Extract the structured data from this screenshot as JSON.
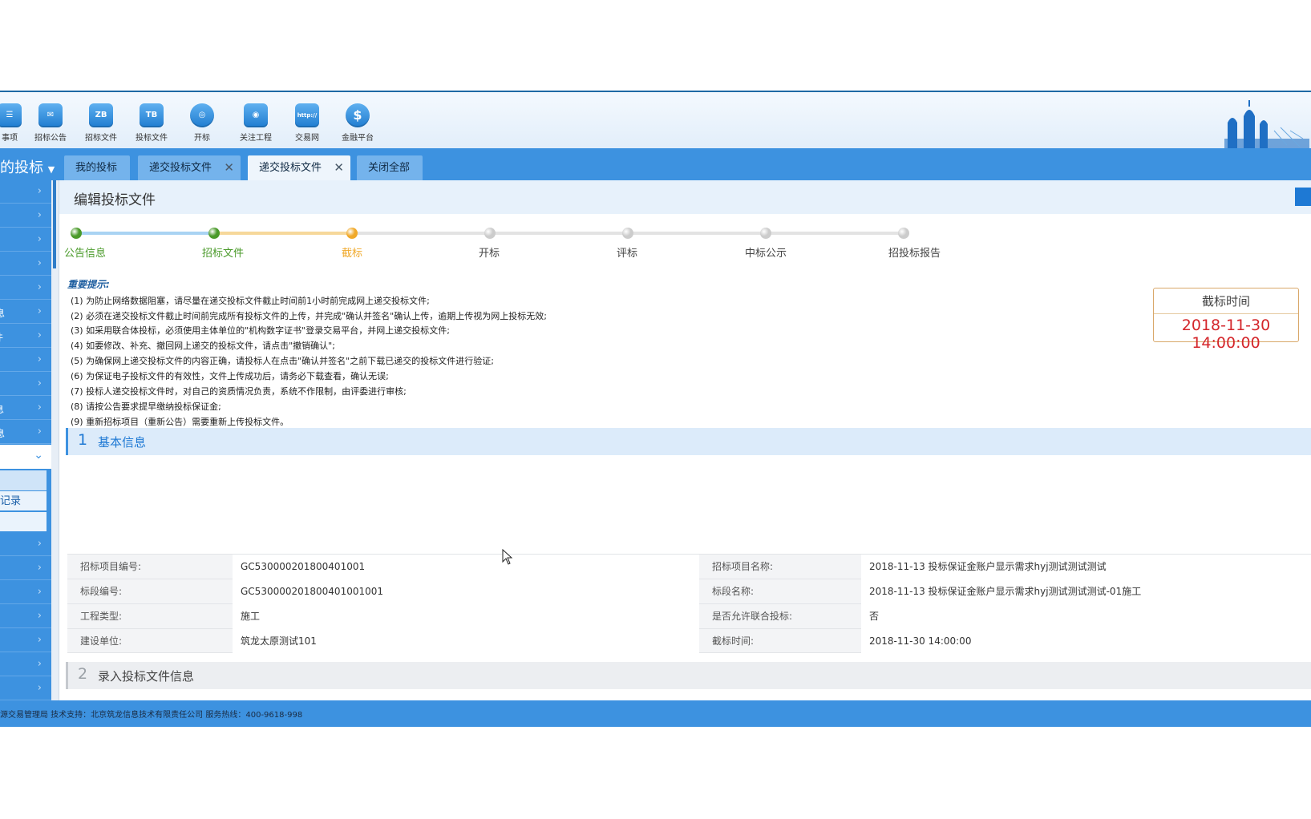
{
  "toolbar": {
    "items": [
      {
        "label": "事项",
        "icon": "tasks-icon"
      },
      {
        "label": "招标公告",
        "icon": "announcement-icon"
      },
      {
        "label": "招标文件",
        "icon": "zb-document-icon",
        "glyph": "ZB"
      },
      {
        "label": "投标文件",
        "icon": "tb-document-icon",
        "glyph": "TB"
      },
      {
        "label": "开标",
        "icon": "target-icon"
      },
      {
        "label": "关注工程",
        "icon": "follow-icon"
      },
      {
        "label": "交易网",
        "icon": "trading-network-icon",
        "glyph": "http://"
      },
      {
        "label": "金融平台",
        "icon": "finance-icon",
        "glyph": "$"
      }
    ]
  },
  "nav": {
    "menu_title": "的投标",
    "tabs": [
      {
        "label": "我的投标",
        "closable": false
      },
      {
        "label": "递交投标文件",
        "closable": true
      },
      {
        "label": "递交投标文件",
        "closable": true,
        "active": true
      },
      {
        "label": "关闭全部",
        "closable": false
      }
    ],
    "close_glyph": "✕"
  },
  "sidebar": {
    "partial_labels": {
      "item6": "息",
      "item7": "件",
      "item10": "息",
      "item11": "息"
    },
    "record_label": "记录"
  },
  "page": {
    "title": "编辑投标文件"
  },
  "steps": [
    {
      "label": "公告信息",
      "status": "done"
    },
    {
      "label": "招标文件",
      "status": "done"
    },
    {
      "label": "截标",
      "status": "current"
    },
    {
      "label": "开标",
      "status": "pending"
    },
    {
      "label": "评标",
      "status": "pending"
    },
    {
      "label": "中标公示",
      "status": "pending"
    },
    {
      "label": "招投标报告",
      "status": "pending"
    }
  ],
  "colors": {
    "done": "#4a9a2a",
    "current": "#f0a92a",
    "pending": "#cccccc",
    "accent": "#3d92e0",
    "deadline_red": "#d4262b"
  },
  "notice": {
    "title": "重要提示:",
    "items": [
      "(1) 为防止网络数据阻塞，请尽量在递交投标文件截止时间前1小时前完成网上递交投标文件;",
      "(2) 必须在递交投标文件截止时间前完成所有投标文件的上传，并完成\"确认并签名\"确认上传，逾期上传视为网上投标无效;",
      "(3) 如采用联合体投标，必须使用主体单位的\"机构数字证书\"登录交易平台，并网上递交投标文件;",
      "(4) 如要修改、补充、撤回网上递交的投标文件，请点击\"撤销确认\";",
      "(5) 为确保网上递交投标文件的内容正确，请投标人在点击\"确认并签名\"之前下载已递交的投标文件进行验证;",
      "(6) 为保证电子投标文件的有效性，文件上传成功后，请务必下载查看，确认无误;",
      "(7) 投标人递交投标文件时，对自己的资质情况负责，系统不作限制，由评委进行审核;",
      "(8) 请按公告要求提早缴纳投标保证金;",
      "(9) 重新招标项目（重新公告）需要重新上传投标文件。"
    ]
  },
  "deadline": {
    "label": "截标时间",
    "value": "2018-11-30 14:00:00"
  },
  "section1": {
    "number": "1",
    "title": "基本信息",
    "rows": [
      {
        "l1": "招标项目编号:",
        "v1": "GC530000201800401001",
        "l2": "招标项目名称:",
        "v2": "2018-11-13 投标保证金账户显示需求hyj测试测试测试"
      },
      {
        "l1": "标段编号:",
        "v1": "GC530000201800401001001",
        "l2": "标段名称:",
        "v2": "2018-11-13 投标保证金账户显示需求hyj测试测试测试-01施工"
      },
      {
        "l1": "工程类型:",
        "v1": "施工",
        "l2": "是否允许联合投标:",
        "v2": "否"
      },
      {
        "l1": "建设单位:",
        "v1": "筑龙太原测试101",
        "l2": "截标时间:",
        "v2": "2018-11-30 14:00:00"
      }
    ]
  },
  "section2": {
    "number": "2",
    "title": "录入投标文件信息"
  },
  "footer": {
    "text": "源交易管理局  技术支持：北京筑龙信息技术有限责任公司  服务热线：400-9618-998"
  }
}
